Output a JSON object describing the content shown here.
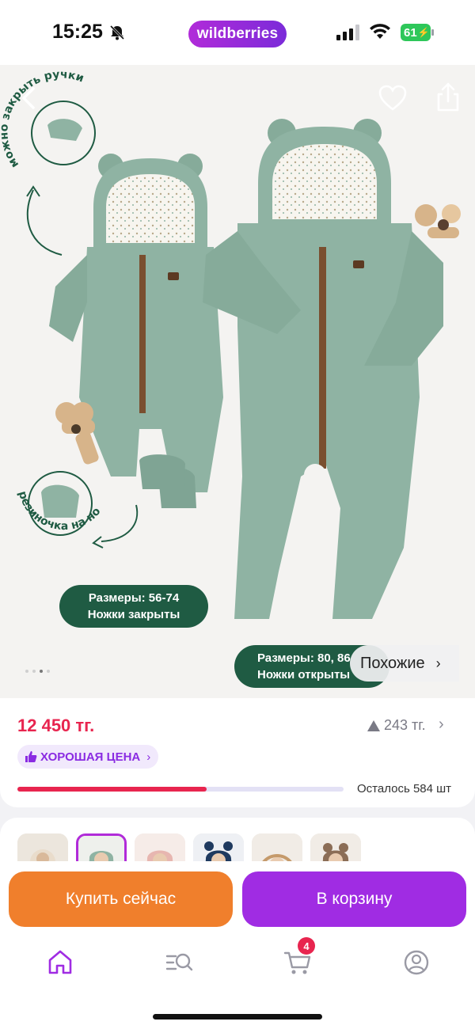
{
  "status_bar": {
    "time": "15:25",
    "brand": "wildberries",
    "battery": "61"
  },
  "product_image": {
    "annotation_top": "можно закрыть ручки",
    "annotation_bottom": "резиночка на ножке",
    "badge_left_line1": "Размеры: 56-74",
    "badge_left_line2": "Ножки закрыты",
    "badge_right_line1": "Размеры: 80, 86",
    "badge_right_line2": "Ножки открыты",
    "similar_label": "Похожие",
    "gallery_dots": 4,
    "active_dot": 3
  },
  "price_block": {
    "price": "12 450 тг.",
    "price_change": "243 тг.",
    "good_price_label": "ХОРОШАЯ ЦЕНА",
    "stock_label": "Осталось 584 шт",
    "stock_fraction": 0.58
  },
  "variants": {
    "count": 6,
    "selected_index": 1
  },
  "actions": {
    "buy_now": "Купить сейчас",
    "add_to_cart": "В корзину"
  },
  "tabbar": {
    "cart_count": "4"
  },
  "colors": {
    "price": "#e8254f",
    "brand_purple": "#a02ce3",
    "buy_orange": "#f07f2c",
    "badge_green": "#1f5b43",
    "garment_green": "#8fb3a3"
  }
}
